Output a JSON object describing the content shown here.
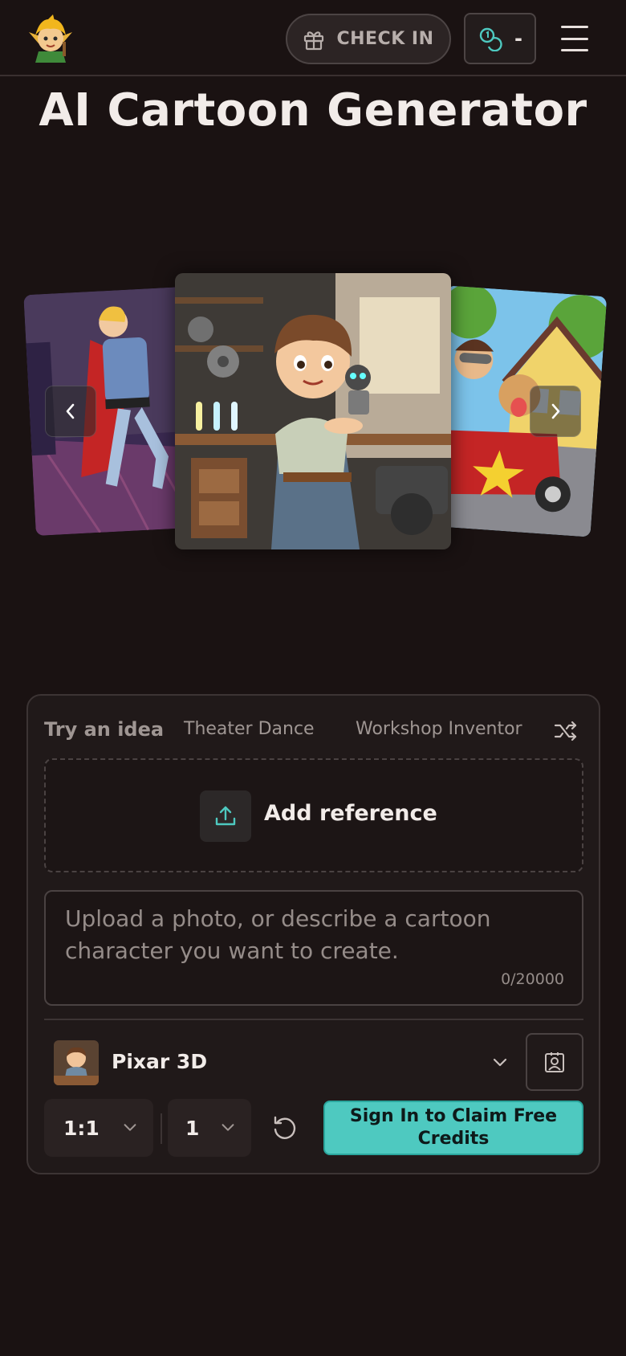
{
  "header": {
    "logo_icon": "elf-mascot-logo",
    "checkin_label": "CHECK IN",
    "checkin_icon": "gift-icon",
    "credits_value": "-",
    "credits_icon": "coins-icon",
    "menu_icon": "hamburger-menu-icon"
  },
  "page": {
    "title": "AI Cartoon Generator"
  },
  "carousel": {
    "slides": [
      {
        "icon": "knight-dancer-image"
      },
      {
        "icon": "workshop-inventor-image"
      },
      {
        "icon": "soapbox-racer-dog-image"
      }
    ],
    "prev_icon": "chevron-left-icon",
    "next_icon": "chevron-right-icon"
  },
  "ideas": {
    "label": "Try an idea",
    "chips": [
      "Theater Dance",
      "Workshop Inventor"
    ],
    "shuffle_icon": "shuffle-icon"
  },
  "upload": {
    "label": "Add reference",
    "icon": "upload-icon"
  },
  "prompt": {
    "placeholder": "Upload a photo, or describe a cartoon character you want to create.",
    "counter": "0/20000"
  },
  "style": {
    "name": "Pixar 3D",
    "caret_icon": "chevron-down-icon",
    "character_icon": "character-portrait-icon"
  },
  "controls": {
    "aspect_ratio": "1:1",
    "image_count": "1",
    "reset_icon": "reset-icon",
    "cta_label": "Sign In to Claim Free Credits"
  },
  "colors": {
    "background": "#1a1212",
    "panel": "#201919",
    "accent": "#4ec9c0",
    "text": "#efe7e4"
  }
}
